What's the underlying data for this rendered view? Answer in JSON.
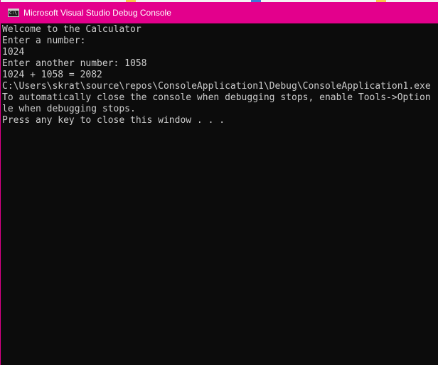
{
  "window": {
    "title": "Microsoft Visual Studio Debug Console",
    "icon": "console-app-icon",
    "icon_glyph": "C:\\",
    "title_bar_color": "#e3008c",
    "background_color": "#0c0c0c",
    "text_color": "#cccccc"
  },
  "console": {
    "lines": [
      "Welcome to the Calculator",
      "Enter a number:",
      "1024",
      "Enter another number: 1058",
      "1024 + 1058 = 2082",
      "C:\\Users\\skrat\\source\\repos\\ConsoleApplication1\\Debug\\ConsoleApplication1.exe",
      "To automatically close the console when debugging stops, enable Tools->Option",
      "le when debugging stops.",
      "Press any key to close this window . . ."
    ]
  }
}
